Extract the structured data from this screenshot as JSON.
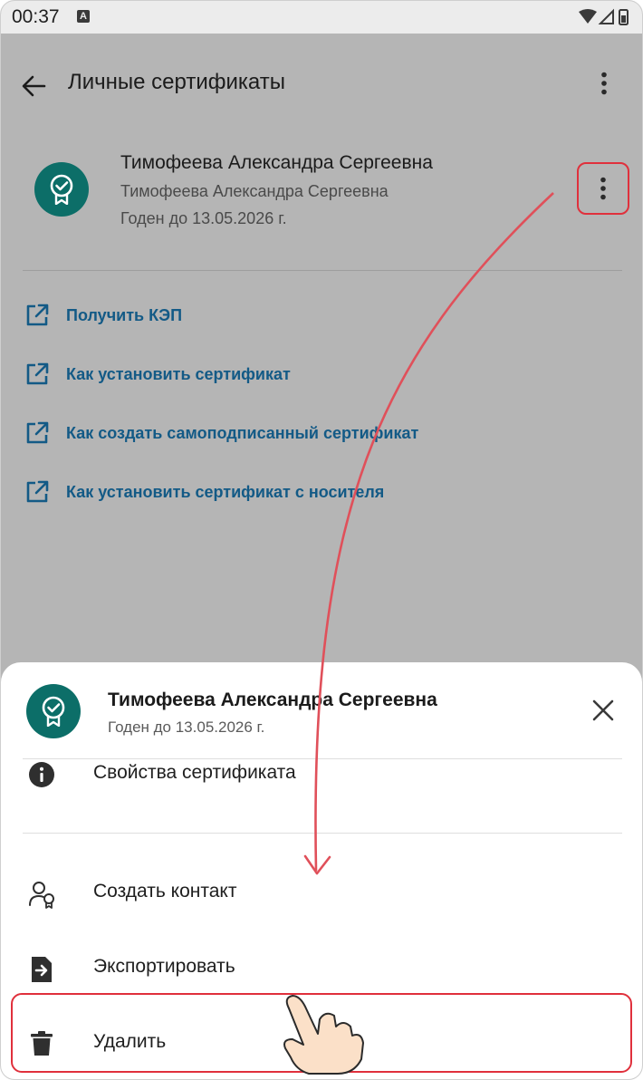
{
  "status": {
    "time": "00:37",
    "notif_badge": "A"
  },
  "appbar": {
    "title": "Личные сертификаты"
  },
  "certificate": {
    "name": "Тимофеева Александра Сергеевна",
    "subject": "Тимофеева Александра Сергеевна",
    "valid_until": "Годен до 13.05.2026 г."
  },
  "links": [
    {
      "label": "Получить КЭП"
    },
    {
      "label": "Как установить сертификат"
    },
    {
      "label": "Как создать самоподписанный сертификат"
    },
    {
      "label": "Как установить сертификат с носителя"
    }
  ],
  "sheet": {
    "name": "Тимофеева Александра Сергеевна",
    "valid_until": "Годен до 13.05.2026 г.",
    "items": [
      {
        "label": "Свойства сертификата",
        "icon": "info-icon"
      },
      {
        "label": "Создать контакт",
        "icon": "contact-icon"
      },
      {
        "label": "Экспортировать",
        "icon": "export-icon"
      },
      {
        "label": "Удалить",
        "icon": "trash-icon"
      }
    ]
  },
  "colors": {
    "accent": "#0c6e68",
    "link": "#135a86",
    "highlight": "#e0303c",
    "scrim": "#b5b5b5"
  }
}
